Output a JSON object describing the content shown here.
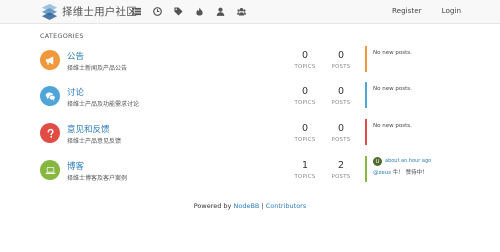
{
  "header": {
    "brand_title": "择维士用户社区",
    "nav_icons": [
      "list-icon",
      "clock-icon",
      "tags-icon",
      "fire-icon",
      "user-icon",
      "users-icon"
    ],
    "register_label": "Register",
    "login_label": "Login"
  },
  "section_title": "CATEGORIES",
  "colors": {
    "announce": "#f0983a",
    "discuss": "#4ea6d8",
    "feedback": "#e04d45",
    "blog": "#86b73f",
    "link": "#2a7ab9"
  },
  "categories": [
    {
      "name": "公告",
      "description": "择维士新闻及产品公告",
      "icon": "bullhorn-icon",
      "topics": "0",
      "posts": "0",
      "topics_label": "TOPICS",
      "posts_label": "POSTS",
      "recent": "No new posts."
    },
    {
      "name": "讨论",
      "description": "择维士产品及功能需求讨论",
      "icon": "comments-icon",
      "topics": "0",
      "posts": "0",
      "topics_label": "TOPICS",
      "posts_label": "POSTS",
      "recent": "No new posts."
    },
    {
      "name": "意见和反馈",
      "description": "择维士产品意见反馈",
      "icon": "question-icon",
      "topics": "0",
      "posts": "0",
      "topics_label": "TOPICS",
      "posts_label": "POSTS",
      "recent": "No new posts."
    },
    {
      "name": "博客",
      "description": "择维士博客及客户案例",
      "icon": "laptop-icon",
      "topics": "1",
      "posts": "2",
      "topics_label": "TOPICS",
      "posts_label": "POSTS",
      "recent_avatar": "U",
      "recent_time": "about an hour ago",
      "recent_user": "@zeus",
      "recent_text": "牛！ 赞待中！"
    }
  ],
  "footer": {
    "prefix": "Powered by",
    "nodebb": "NodeBB",
    "separator": "|",
    "contributors": "Contributors"
  }
}
